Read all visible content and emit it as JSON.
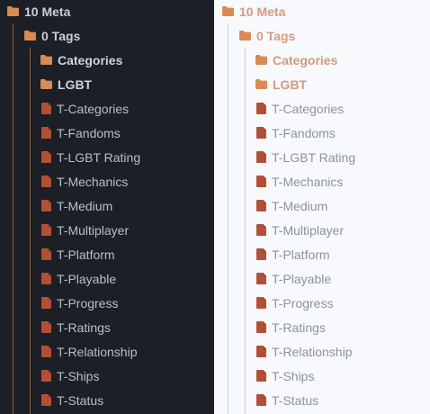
{
  "panes": [
    {
      "theme": "dark",
      "root_folder": "10 Meta",
      "sub_folder": "0 Tags",
      "categories": [
        "Categories",
        "LGBT"
      ],
      "files": [
        "T-Categories",
        "T-Fandoms",
        "T-LGBT Rating",
        "T-Mechanics",
        "T-Medium",
        "T-Multiplayer",
        "T-Platform",
        "T-Playable",
        "T-Progress",
        "T-Ratings",
        "T-Relationship",
        "T-Ships",
        "T-Status"
      ]
    },
    {
      "theme": "light",
      "root_folder": "10 Meta",
      "sub_folder": "0 Tags",
      "categories": [
        "Categories",
        "LGBT"
      ],
      "files": [
        "T-Categories",
        "T-Fandoms",
        "T-LGBT Rating",
        "T-Mechanics",
        "T-Medium",
        "T-Multiplayer",
        "T-Platform",
        "T-Playable",
        "T-Progress",
        "T-Ratings",
        "T-Relationship",
        "T-Ships",
        "T-Status"
      ]
    }
  ],
  "colors": {
    "folder_icon": "#d98b53",
    "file_icon": "#b25037",
    "dark_bg": "#1c1f25",
    "light_bg": "#f7f9fc"
  },
  "icons": {
    "folder": "folder-icon",
    "file": "file-icon"
  }
}
